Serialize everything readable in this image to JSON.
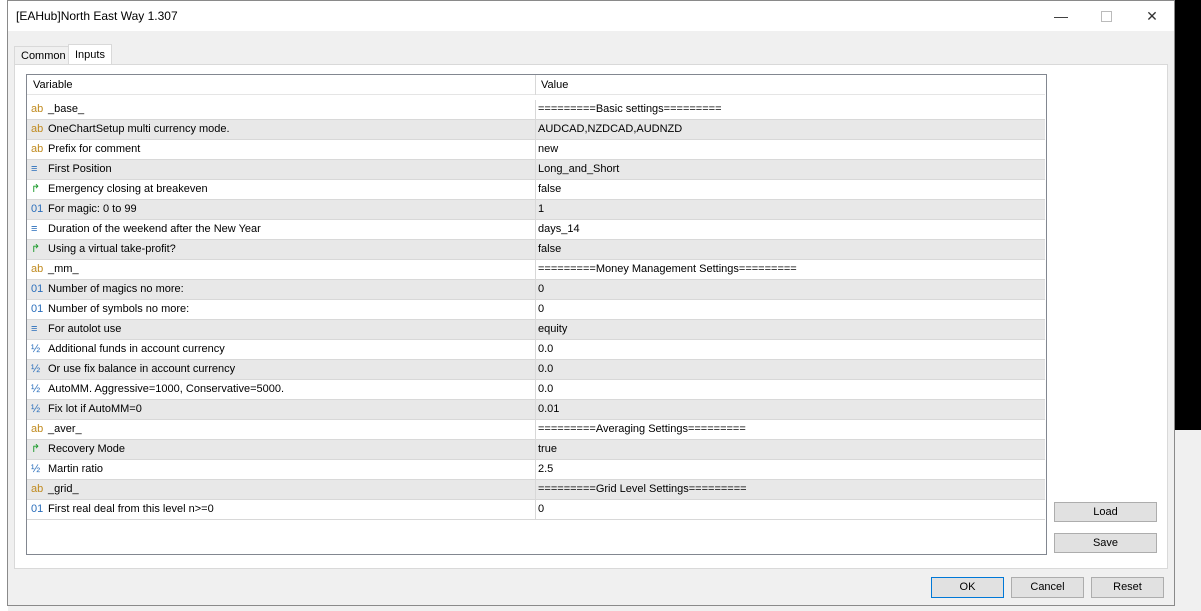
{
  "window": {
    "title": "[EAHub]North East Way 1.307"
  },
  "tabs": [
    {
      "label": "Common"
    },
    {
      "label": "Inputs"
    }
  ],
  "table": {
    "headers": {
      "variable": "Variable",
      "value": "Value"
    },
    "rows": [
      {
        "type": "string",
        "icon": "ab",
        "variable": "_base_",
        "value": "=========Basic settings========="
      },
      {
        "type": "string",
        "icon": "ab",
        "variable": "OneChartSetup multi currency mode.",
        "value": "AUDCAD,NZDCAD,AUDNZD"
      },
      {
        "type": "string",
        "icon": "ab",
        "variable": "Prefix for comment",
        "value": "new"
      },
      {
        "type": "enum",
        "icon": "≡",
        "variable": "First Position",
        "value": "Long_and_Short"
      },
      {
        "type": "bool",
        "icon": "↱",
        "variable": "Emergency closing at breakeven",
        "value": "false"
      },
      {
        "type": "int",
        "icon": "01",
        "variable": "For magic: 0 to 99",
        "value": "1"
      },
      {
        "type": "enum",
        "icon": "≡",
        "variable": "Duration of the weekend after the New Year",
        "value": "days_14"
      },
      {
        "type": "bool",
        "icon": "↱",
        "variable": "Using a virtual take-profit?",
        "value": "false"
      },
      {
        "type": "string",
        "icon": "ab",
        "variable": "_mm_",
        "value": "=========Money Management Settings========="
      },
      {
        "type": "int",
        "icon": "01",
        "variable": "Number of magics no more:",
        "value": "0"
      },
      {
        "type": "int",
        "icon": "01",
        "variable": "Number of symbols no more:",
        "value": "0"
      },
      {
        "type": "enum",
        "icon": "≡",
        "variable": "For autolot use",
        "value": "equity"
      },
      {
        "type": "double",
        "icon": "½",
        "variable": "Additional funds in account currency",
        "value": "0.0"
      },
      {
        "type": "double",
        "icon": "½",
        "variable": "Or use fix balance in account currency",
        "value": "0.0"
      },
      {
        "type": "double",
        "icon": "½",
        "variable": "AutoMM. Aggressive=1000, Conservative=5000.",
        "value": "0.0"
      },
      {
        "type": "double",
        "icon": "½",
        "variable": "Fix lot if AutoMM=0",
        "value": "0.01"
      },
      {
        "type": "string",
        "icon": "ab",
        "variable": "_aver_",
        "value": "=========Averaging Settings========="
      },
      {
        "type": "bool",
        "icon": "↱",
        "variable": "Recovery Mode",
        "value": "true"
      },
      {
        "type": "double",
        "icon": "½",
        "variable": "Martin ratio",
        "value": "2.5"
      },
      {
        "type": "string",
        "icon": "ab",
        "variable": "_grid_",
        "value": "=========Grid Level Settings========="
      },
      {
        "type": "int",
        "icon": "01",
        "variable": "First real deal from this level n>=0",
        "value": "0"
      }
    ]
  },
  "buttons": {
    "load": "Load",
    "save": "Save",
    "ok": "OK",
    "cancel": "Cancel",
    "reset": "Reset"
  },
  "colors": {
    "string": "#c08a1e",
    "int": "#2a6ebb",
    "double": "#2a6ebb",
    "enum": "#2a6ebb",
    "bool": "#1a9a2a"
  }
}
